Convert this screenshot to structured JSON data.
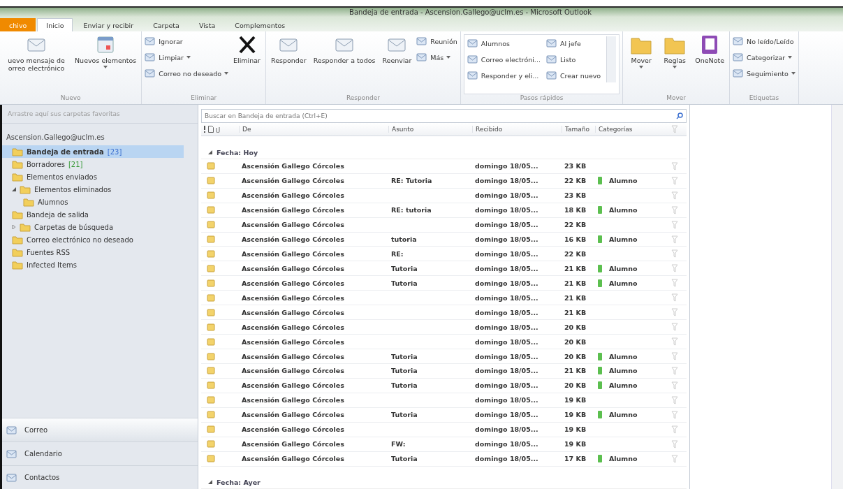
{
  "window": {
    "title": "Bandeja de entrada - Ascension.Gallego@uclm.es - Microsoft Outlook"
  },
  "tabs": [
    {
      "label": "chivo",
      "kind": "file",
      "selected": false
    },
    {
      "label": "Inicio",
      "kind": "tab",
      "selected": true
    },
    {
      "label": "Enviar y recibir",
      "kind": "tab",
      "selected": false
    },
    {
      "label": "Carpeta",
      "kind": "tab",
      "selected": false
    },
    {
      "label": "Vista",
      "kind": "tab",
      "selected": false
    },
    {
      "label": "Complementos",
      "kind": "tab",
      "selected": false
    }
  ],
  "ribbon": [
    {
      "name": "Nuevo",
      "items": [
        {
          "kind": "mail",
          "label": "uevo mensaje de orreo electrónico"
        },
        {
          "kind": "calendar",
          "label": "Nuevos elementos",
          "dropdown": true
        }
      ]
    },
    {
      "name": "Eliminar",
      "items": [
        {
          "kind": "stack",
          "children": [
            {
              "label": "Ignorar"
            },
            {
              "label": "Limpiar",
              "dropdown": true
            },
            {
              "label": "Correo no deseado",
              "dropdown": true
            }
          ]
        },
        {
          "kind": "delete",
          "label": "Eliminar"
        }
      ]
    },
    {
      "name": "Responder",
      "items": [
        {
          "kind": "mail",
          "label": "Responder"
        },
        {
          "kind": "mail",
          "label": "Responder a todos"
        },
        {
          "kind": "mail",
          "label": "Reenviar"
        },
        {
          "kind": "stack",
          "children": [
            {
              "label": "Reunión"
            },
            {
              "label": "Más",
              "dropdown": true
            }
          ]
        }
      ]
    },
    {
      "name": "Pasos rápidos",
      "items": [
        {
          "kind": "gallery",
          "children": [
            {
              "label": "Alumnos"
            },
            {
              "label": "Al jefe"
            },
            {
              "label": "Correo electróni..."
            },
            {
              "label": "Listo"
            },
            {
              "label": "Responder y eli..."
            },
            {
              "label": "Crear nuevo"
            }
          ]
        }
      ]
    },
    {
      "name": "Mover",
      "items": [
        {
          "kind": "folder",
          "label": "Mover",
          "dropdown": true
        },
        {
          "kind": "folder",
          "label": "Reglas",
          "dropdown": true
        },
        {
          "kind": "notebook",
          "label": "OneNote"
        }
      ]
    },
    {
      "name": "Etiquetas",
      "items": [
        {
          "kind": "stack",
          "children": [
            {
              "label": "No leído/Leído"
            },
            {
              "label": "Categorizar",
              "dropdown": true
            },
            {
              "label": "Seguimiento",
              "dropdown": true
            }
          ]
        }
      ]
    }
  ],
  "sidebar": {
    "favorites_hint": "Arrastre aquí sus carpetas favoritas",
    "account": "Ascension.Gallego@uclm.es",
    "folders": [
      {
        "label": "Bandeja de entrada",
        "count": "[23]",
        "color": "#3a6fd0",
        "selected": true,
        "bold": true
      },
      {
        "label": "Borradores",
        "count": "[21]",
        "color": "#3a9a3a",
        "selected": false,
        "bold": false
      },
      {
        "label": "Elementos enviados",
        "selected": false,
        "bold": false
      },
      {
        "label": "Elementos eliminados",
        "selected": false,
        "bold": false,
        "expanded": true,
        "children": [
          {
            "label": "Alumnos",
            "selected": false,
            "bold": false
          }
        ]
      },
      {
        "label": "Bandeja de salida",
        "selected": false,
        "bold": false
      },
      {
        "label": "Carpetas de búsqueda",
        "selected": false,
        "bold": false,
        "expanded": false
      },
      {
        "label": "Correo electrónico no deseado",
        "selected": false,
        "bold": false
      },
      {
        "label": "Fuentes RSS",
        "selected": false,
        "bold": false
      },
      {
        "label": "Infected Items",
        "selected": false,
        "bold": false
      }
    ],
    "nav": [
      {
        "label": "Correo",
        "selected": true
      },
      {
        "label": "Calendario",
        "selected": false
      },
      {
        "label": "Contactos",
        "selected": false
      }
    ]
  },
  "search": {
    "placeholder": "Buscar en Bandeja de entrada (Ctrl+E)"
  },
  "table": {
    "columns": [
      "De",
      "Asunto",
      "Recibido",
      "Tamaño",
      "Categorías"
    ],
    "groups": [
      {
        "label": "Fecha: Hoy",
        "expanded": true,
        "rows": [
          {
            "from": "Ascensión Gallego Córcoles",
            "received": "domingo 18/05...",
            "size": "23 KB"
          },
          {
            "from": "Ascensión Gallego Córcoles",
            "subject": "RE: Tutoria",
            "received": "domingo 18/05...",
            "size": "22 KB",
            "category": "Alumno"
          },
          {
            "from": "Ascensión Gallego Córcoles",
            "received": "domingo 18/05...",
            "size": "23 KB"
          },
          {
            "from": "Ascensión Gallego Córcoles",
            "subject": "RE: tutoria",
            "received": "domingo 18/05...",
            "size": "18 KB",
            "category": "Alumno"
          },
          {
            "from": "Ascensión Gallego Córcoles",
            "received": "domingo 18/05...",
            "size": "22 KB"
          },
          {
            "from": "Ascensión Gallego Córcoles",
            "subject": "tutoria",
            "received": "domingo 18/05...",
            "size": "16 KB",
            "category": "Alumno"
          },
          {
            "from": "Ascensión Gallego Córcoles",
            "subject": "RE:",
            "received": "domingo 18/05...",
            "size": "22 KB"
          },
          {
            "from": "Ascensión Gallego Córcoles",
            "subject": "Tutoria",
            "received": "domingo 18/05...",
            "size": "21 KB",
            "category": "Alumno"
          },
          {
            "from": "Ascensión Gallego Córcoles",
            "subject": "Tutoria",
            "received": "domingo 18/05...",
            "size": "21 KB",
            "category": "Alumno"
          },
          {
            "from": "Ascensión Gallego Córcoles",
            "received": "domingo 18/05...",
            "size": "21 KB"
          },
          {
            "from": "Ascensión Gallego Córcoles",
            "received": "domingo 18/05...",
            "size": "21 KB"
          },
          {
            "from": "Ascensión Gallego Córcoles",
            "received": "domingo 18/05...",
            "size": "20 KB"
          },
          {
            "from": "Ascensión Gallego Córcoles",
            "received": "domingo 18/05...",
            "size": "20 KB"
          },
          {
            "from": "Ascensión Gallego Córcoles",
            "subject": "Tutoria",
            "received": "domingo 18/05...",
            "size": "20 KB",
            "category": "Alumno"
          },
          {
            "from": "Ascensión Gallego Córcoles",
            "subject": "Tutoria",
            "received": "domingo 18/05...",
            "size": "21 KB",
            "category": "Alumno"
          },
          {
            "from": "Ascensión Gallego Córcoles",
            "subject": "Tutoria",
            "received": "domingo 18/05...",
            "size": "20 KB",
            "category": "Alumno"
          },
          {
            "from": "Ascensión Gallego Córcoles",
            "received": "domingo 18/05...",
            "size": "19 KB"
          },
          {
            "from": "Ascensión Gallego Córcoles",
            "subject": "Tutoria",
            "received": "domingo 18/05...",
            "size": "19 KB",
            "category": "Alumno"
          },
          {
            "from": "Ascensión Gallego Córcoles",
            "received": "domingo 18/05...",
            "size": "19 KB"
          },
          {
            "from": "Ascensión Gallego Córcoles",
            "subject": "FW:",
            "received": "domingo 18/05...",
            "size": "19 KB"
          },
          {
            "from": "Ascensión Gallego Córcoles",
            "subject": "Tutoria",
            "received": "domingo 18/05...",
            "size": "17 KB",
            "category": "Alumno"
          }
        ]
      },
      {
        "label": "Fecha: Ayer",
        "expanded": true
      }
    ]
  }
}
